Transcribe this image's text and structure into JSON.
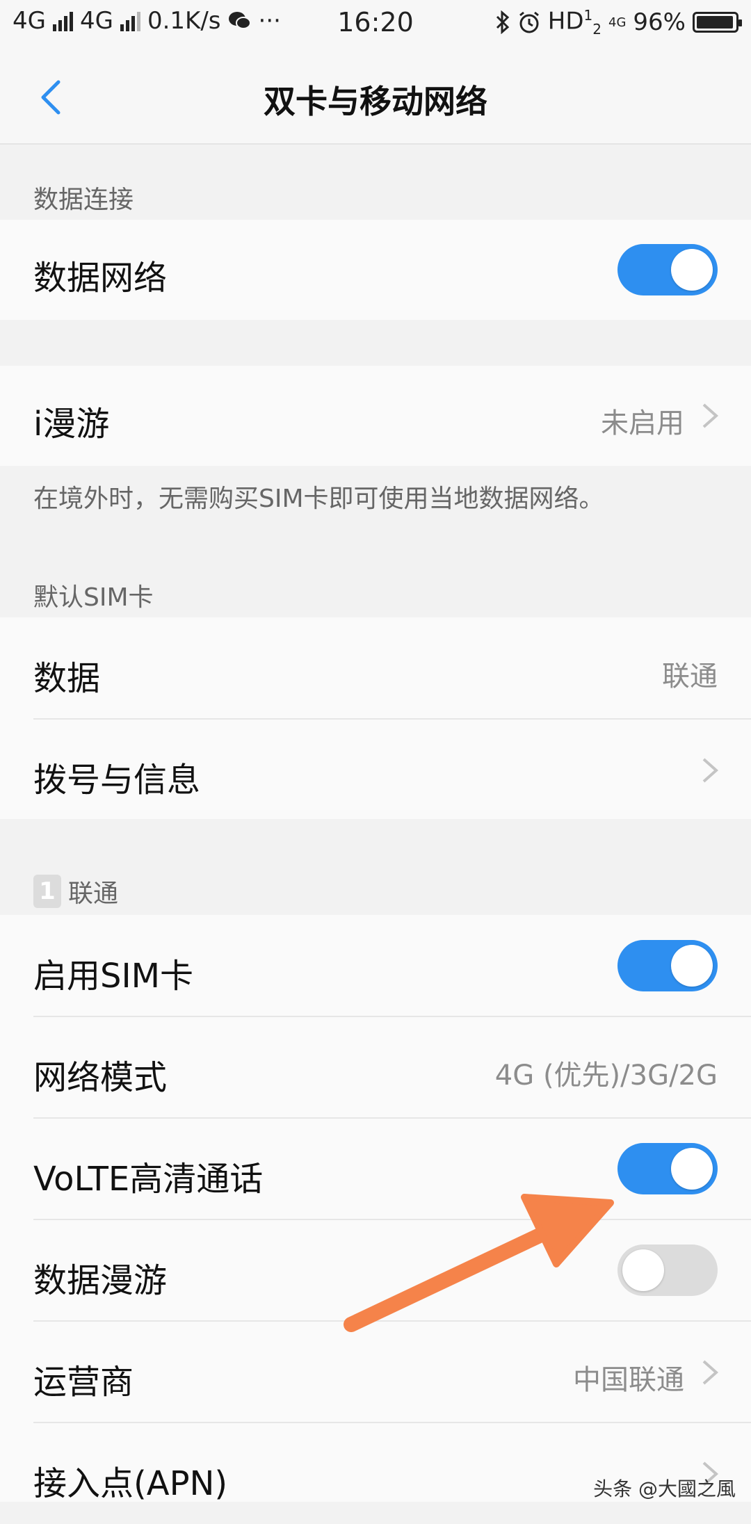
{
  "status_bar": {
    "sim1_network": "4G",
    "sim2_network": "4G",
    "speed": "0.1K/s",
    "more": "···",
    "time": "16:20",
    "hd": "HD",
    "hd_sub": "1",
    "hd_sub2": "2",
    "net_badge": "4G",
    "battery_percent": "96%",
    "battery_level": 0.96
  },
  "header": {
    "title": "双卡与移动网络"
  },
  "sections": {
    "data_connection": {
      "label": "数据连接",
      "data_network": {
        "label": "数据网络",
        "enabled": true
      }
    },
    "roaming": {
      "label": "i漫游",
      "value": "未启用",
      "description": "在境外时，无需购买SIM卡即可使用当地数据网络。"
    },
    "default_sim": {
      "label": "默认SIM卡",
      "data": {
        "label": "数据",
        "value": "联通"
      },
      "dial_msg": {
        "label": "拨号与信息"
      }
    },
    "sim1": {
      "badge": "1",
      "label": "联通",
      "enable_sim": {
        "label": "启用SIM卡",
        "enabled": true
      },
      "network_mode": {
        "label": "网络模式",
        "value": "4G (优先)/3G/2G"
      },
      "volte": {
        "label": "VoLTE高清通话",
        "enabled": true
      },
      "data_roaming": {
        "label": "数据漫游",
        "enabled": false
      },
      "carrier": {
        "label": "运营商",
        "value": "中国联通"
      },
      "apn": {
        "label": "接入点(APN)"
      }
    }
  },
  "watermark": "头条 @大國之風",
  "colors": {
    "toggle_on": "#2e8ff0",
    "toggle_off": "#dcdcdc",
    "arrow": "#f5834a",
    "back_icon": "#2e8ff0"
  }
}
